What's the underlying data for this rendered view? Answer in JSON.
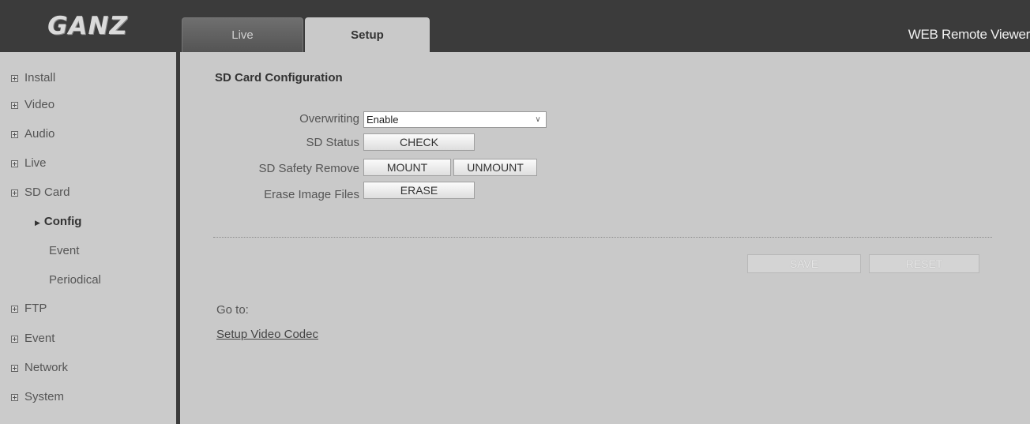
{
  "header": {
    "logo_text": "GANZ",
    "tabs": [
      {
        "label": "Live",
        "active": false
      },
      {
        "label": "Setup",
        "active": true
      }
    ],
    "app_title": "WEB Remote Viewer"
  },
  "sidebar": {
    "items": [
      {
        "label": "Install",
        "icon": "expand-plus-icon"
      },
      {
        "label": "Video",
        "icon": "expand-plus-icon"
      },
      {
        "label": "Audio",
        "icon": "expand-plus-icon"
      },
      {
        "label": "Live",
        "icon": "expand-plus-icon"
      },
      {
        "label": "SD Card",
        "icon": "expand-plus-icon",
        "expanded": true,
        "children": [
          {
            "label": "Config",
            "active": true
          },
          {
            "label": "Event"
          },
          {
            "label": "Periodical"
          }
        ]
      },
      {
        "label": "FTP",
        "icon": "expand-plus-icon"
      },
      {
        "label": "Event",
        "icon": "expand-plus-icon"
      },
      {
        "label": "Network",
        "icon": "expand-plus-icon"
      },
      {
        "label": "System",
        "icon": "expand-plus-icon"
      }
    ]
  },
  "main": {
    "title": "SD Card Configuration",
    "form": {
      "overwriting_label": "Overwriting",
      "overwriting_value": "Enable",
      "sd_status_label": "SD Status",
      "check_button": "CHECK",
      "safety_remove_label": "SD Safety Remove",
      "mount_button": "MOUNT",
      "unmount_button": "UNMOUNT",
      "erase_label": "Erase Image Files",
      "erase_button": "ERASE"
    },
    "save_button": "SAVE",
    "reset_button": "RESET",
    "goto_label": "Go to:",
    "goto_link": "Setup Video Codec"
  },
  "colors": {
    "header_bg": "#3b3b3b",
    "page_bg": "#c9c9c9"
  }
}
